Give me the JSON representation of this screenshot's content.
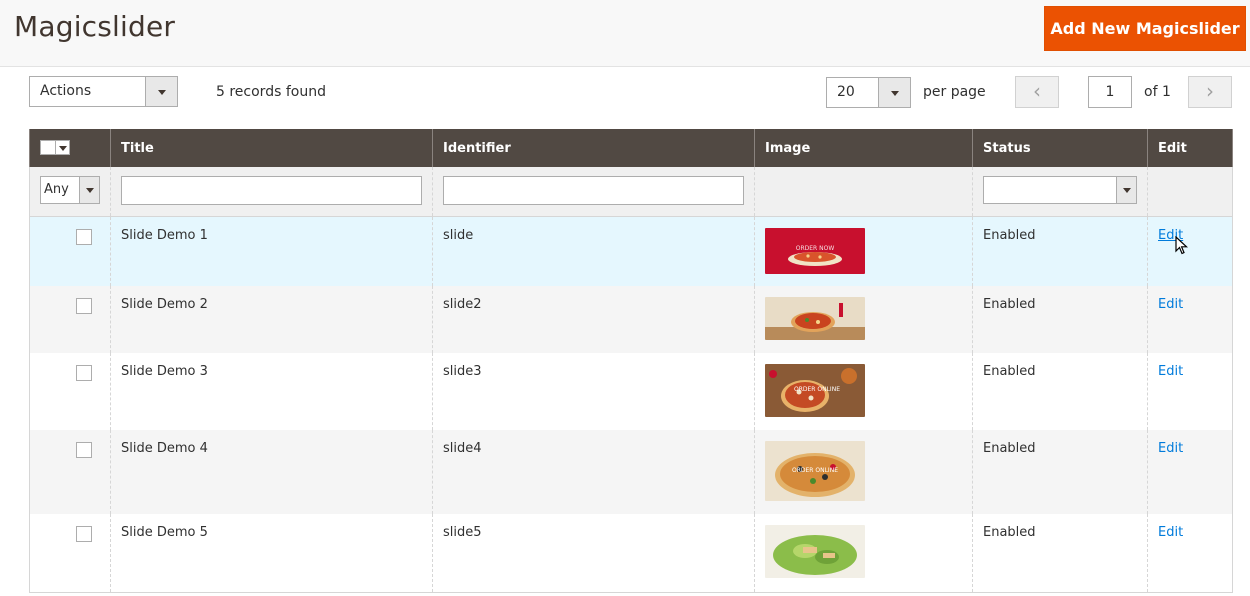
{
  "header": {
    "title": "Magicslider",
    "add_button": "Add New Magicslider"
  },
  "toolbar": {
    "actions_label": "Actions",
    "records_found": "5 records found",
    "per_page_value": "20",
    "per_page_label": "per page",
    "current_page": "1",
    "of_pages": "of 1",
    "prev_icon": "‹",
    "next_icon": "›"
  },
  "grid": {
    "columns": [
      "Title",
      "Identifier",
      "Image",
      "Status",
      "Edit"
    ],
    "filter": {
      "any_label": "Any"
    },
    "rows": [
      {
        "title": "Slide Demo 1",
        "identifier": "slide",
        "status": "Enabled",
        "edit": "Edit",
        "image": "pizza-red-background"
      },
      {
        "title": "Slide Demo 2",
        "identifier": "slide2",
        "status": "Enabled",
        "edit": "Edit",
        "image": "pizza-wood-board"
      },
      {
        "title": "Slide Demo 3",
        "identifier": "slide3",
        "status": "Enabled",
        "edit": "Edit",
        "image": "pizza-order-online-1"
      },
      {
        "title": "Slide Demo 4",
        "identifier": "slide4",
        "status": "Enabled",
        "edit": "Edit",
        "image": "pizza-order-online-2"
      },
      {
        "title": "Slide Demo 5",
        "identifier": "slide5",
        "status": "Enabled",
        "edit": "Edit",
        "image": "salad"
      }
    ]
  },
  "colors": {
    "accent": "#eb5202",
    "header_bg": "#514943",
    "link": "#007bdb",
    "hover_row": "#e5f7fe"
  }
}
